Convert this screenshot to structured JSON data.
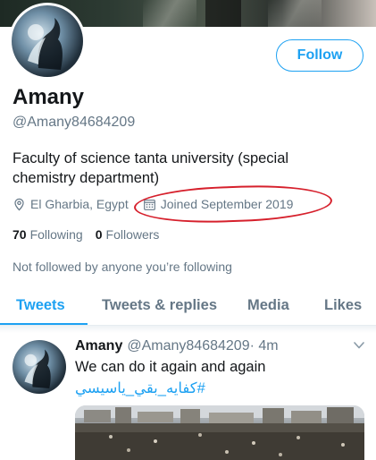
{
  "profile": {
    "display_name": "Amany",
    "handle": "@Amany84684209",
    "bio": "Faculty of science tanta university (special chemistry department)",
    "location": "El Gharbia, Egypt",
    "joined": "Joined September 2019",
    "following_count": "70",
    "following_label": "Following",
    "followers_count": "0",
    "followers_label": "Followers",
    "not_followed_text": "Not followed by anyone you’re following",
    "follow_button_label": "Follow"
  },
  "tabs": [
    {
      "label": "Tweets",
      "active": true
    },
    {
      "label": "Tweets & replies",
      "active": false
    },
    {
      "label": "Media",
      "active": false
    },
    {
      "label": "Likes",
      "active": false
    }
  ],
  "tweet": {
    "name": "Amany",
    "handle": "@Amany84684209",
    "time": "· 4m",
    "text": "We can do it again and again",
    "hashtag": "#كفايه_بقي_ياسيسي"
  },
  "colors": {
    "accent": "#1da1f2",
    "secondary_text": "#657786",
    "highlight_circle": "#d6202c"
  },
  "icons": {
    "location": "location-pin-icon",
    "calendar": "calendar-icon",
    "caret": "chevron-down-icon"
  }
}
